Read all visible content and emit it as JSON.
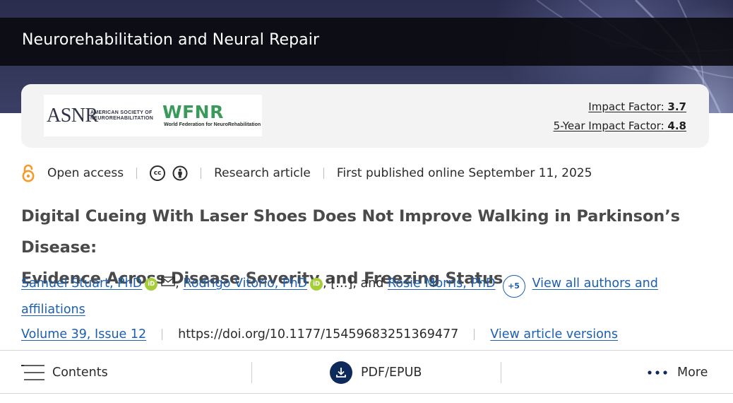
{
  "journal": {
    "title": "Neurorehabilitation and Neural Repair"
  },
  "logos": {
    "asnr": {
      "mark": "ASNR",
      "line1": "AMERICAN SOCIETY OF",
      "line2": "NEUROREHABILITATION"
    },
    "wfnr": {
      "mark": "WFNR",
      "subtitle": "World Federation for NeuroRehabilitation"
    }
  },
  "metrics": {
    "impact_label": "Impact Factor:",
    "impact_value": "3.7",
    "five_year_label": "5-Year Impact Factor:",
    "five_year_value": "4.8"
  },
  "meta": {
    "access": "Open access",
    "license_cc": "cc",
    "article_type": "Research article",
    "published": "First published online September 11, 2025"
  },
  "article": {
    "title_line1": "Digital Cueing With Laser Shoes Does Not Improve Walking in Parkinson’s Disease:",
    "title_line2": "Evidence Across Disease Severity and Freezing Status"
  },
  "authors": {
    "author1": "Samuel Stuart, PhD",
    "comma1": ",",
    "author2": "Rodrigo Vitorio, PhD",
    "ellipsis": ", […], and",
    "author3": "Rosie Morris, PhD",
    "more_count": "+5",
    "view_all_part1": "View all authors and",
    "view_all_part2": "affiliations",
    "orcid_label": "iD"
  },
  "issue": {
    "volume": "Volume 39, Issue 12",
    "doi": "https://doi.org/10.1177/15459683251369477",
    "versions": "View article versions"
  },
  "toolbar": {
    "contents": "Contents",
    "pdf": "PDF/EPUB",
    "more": "More"
  },
  "colors": {
    "link": "#1c5fae",
    "open_access": "#f39c2c",
    "orcid": "#a6ce39",
    "pdf_button": "#0e2a5a",
    "wfnr_green": "#3a9a5c"
  },
  "icons": [
    "open-access-icon",
    "cc-icon",
    "cc-by-icon",
    "orcid-icon",
    "mail-icon",
    "menu-icon",
    "download-icon",
    "more-icon"
  ]
}
